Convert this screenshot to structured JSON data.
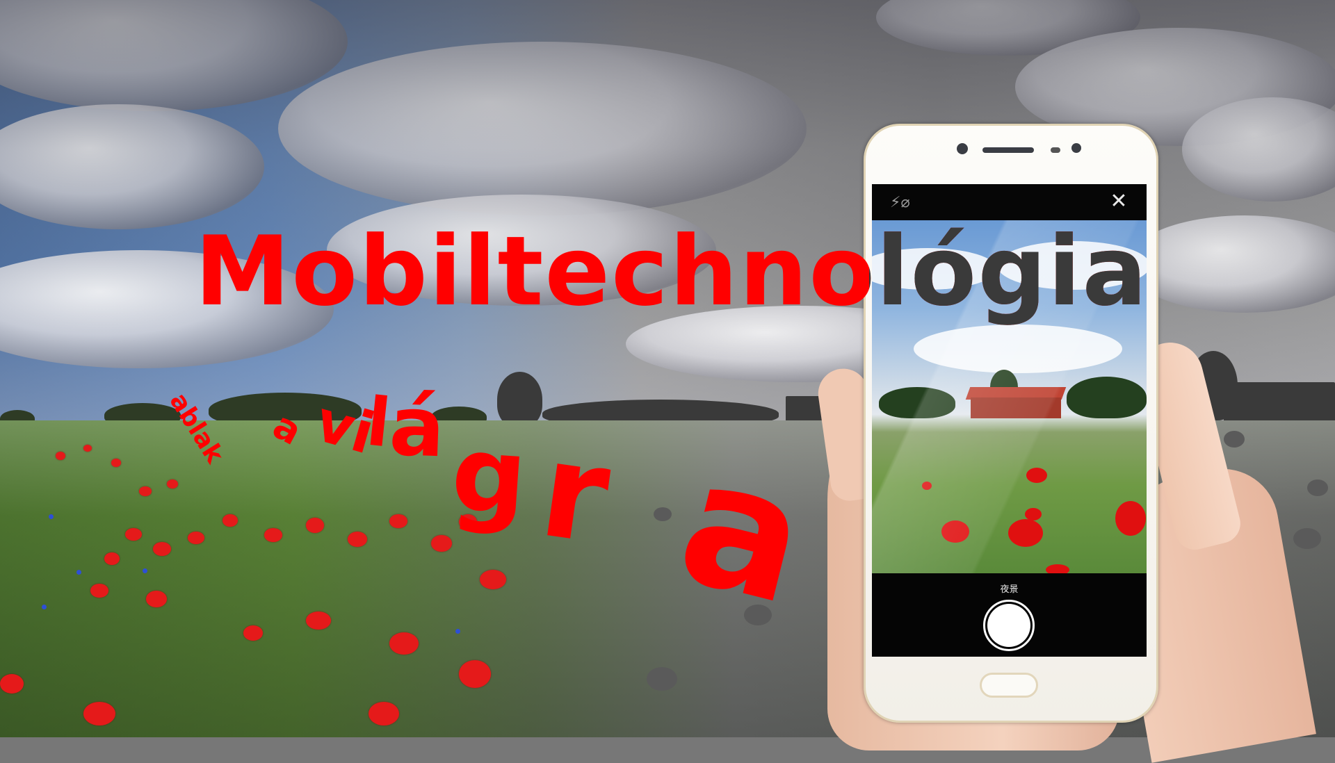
{
  "poster": {
    "title": "Mobiltechnológia",
    "subtitle_words": [
      "ablak",
      "a",
      "vi",
      "l",
      "á",
      "g",
      "r",
      "a"
    ],
    "accent_color": "#ff0000"
  },
  "phone_camera": {
    "mode_label": "夜景",
    "flash_icon": "flash-off-icon",
    "close_icon": "close-icon",
    "shutter_icon": "shutter-button"
  }
}
